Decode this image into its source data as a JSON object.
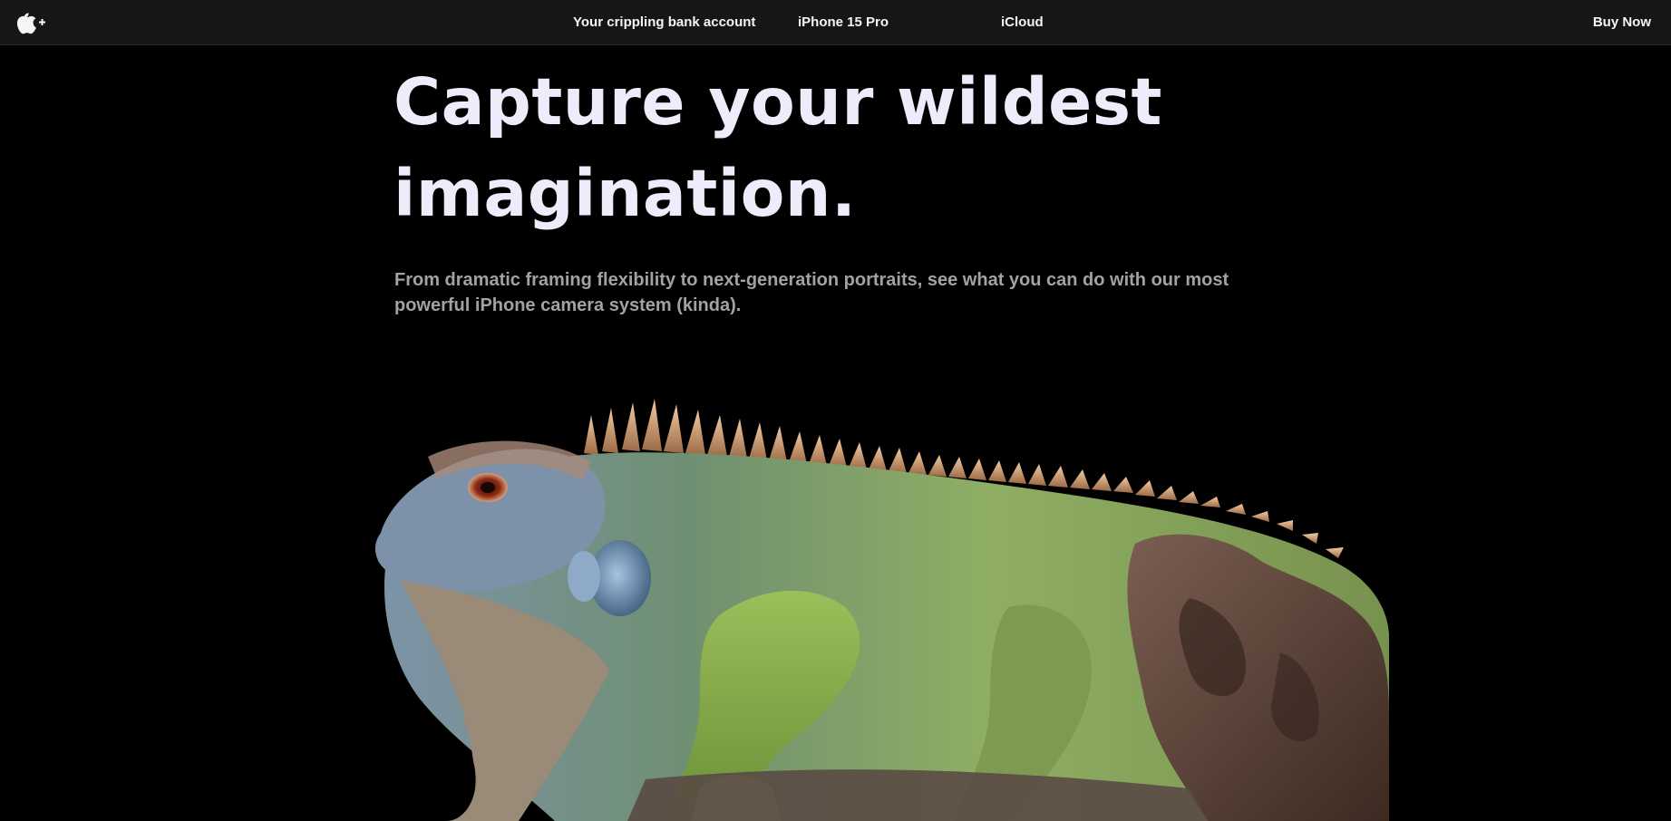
{
  "nav": {
    "logo_icon": "apple-plus-logo-icon",
    "links": [
      {
        "label": "Your crippling bank account"
      },
      {
        "label": "iPhone 15 Pro"
      },
      {
        "label": "iCloud"
      }
    ],
    "buy_label": "Buy Now"
  },
  "hero": {
    "headline_line1": "Capture your wildest",
    "headline_line2": "imagination.",
    "subheadline": "From dramatic framing flexibility to next-generation portraits, see what you can do with our most powerful iPhone camera system (kinda).",
    "image_subject": "iguana"
  },
  "colors": {
    "background": "#000000",
    "nav_background": "#161617",
    "headline": "#ececfb",
    "subheadline": "#a1a1a6",
    "nav_text": "#f5f5f7"
  }
}
